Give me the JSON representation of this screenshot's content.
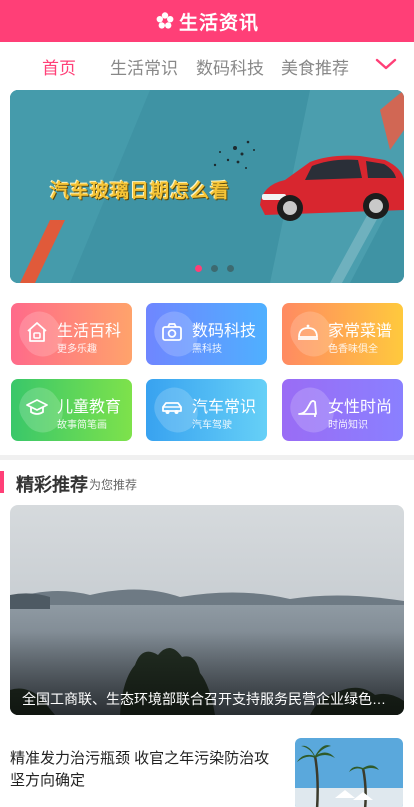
{
  "header": {
    "title": "生活资讯",
    "logo_icon": "flower-logo-icon"
  },
  "tabs": [
    {
      "label": "首页",
      "active": true
    },
    {
      "label": "生活常识",
      "active": false
    },
    {
      "label": "数码科技",
      "active": false
    },
    {
      "label": "美食推荐",
      "active": false
    }
  ],
  "tabs_more_icon": "chevron-down-icon",
  "banner": {
    "caption": "汽车玻璃日期怎么看",
    "slide_count": 3,
    "active_slide": 1
  },
  "categories": [
    {
      "title": "生活百科",
      "subtitle": "更多乐趣",
      "icon": "house-icon"
    },
    {
      "title": "数码科技",
      "subtitle": "黑科技",
      "icon": "camera-icon"
    },
    {
      "title": "家常菜谱",
      "subtitle": "色香味俱全",
      "icon": "dish-cover-icon"
    },
    {
      "title": "儿童教育",
      "subtitle": "故事简笔画",
      "icon": "graduation-cap-icon"
    },
    {
      "title": "汽车常识",
      "subtitle": "汽车驾驶",
      "icon": "car-icon"
    },
    {
      "title": "女性时尚",
      "subtitle": "时尚知识",
      "icon": "high-heel-icon"
    }
  ],
  "section": {
    "title": "精彩推荐",
    "subtitle": "为您推荐"
  },
  "featured": {
    "caption": "全国工商联、生态环境部联合召开支持服务民营企业绿色发展"
  },
  "news": [
    {
      "title": "精准发力治污瓶颈 收官之年污染防治攻坚方向确定"
    }
  ],
  "colors": {
    "accent": "#ff3f77",
    "divider": "#f0f0f0"
  }
}
